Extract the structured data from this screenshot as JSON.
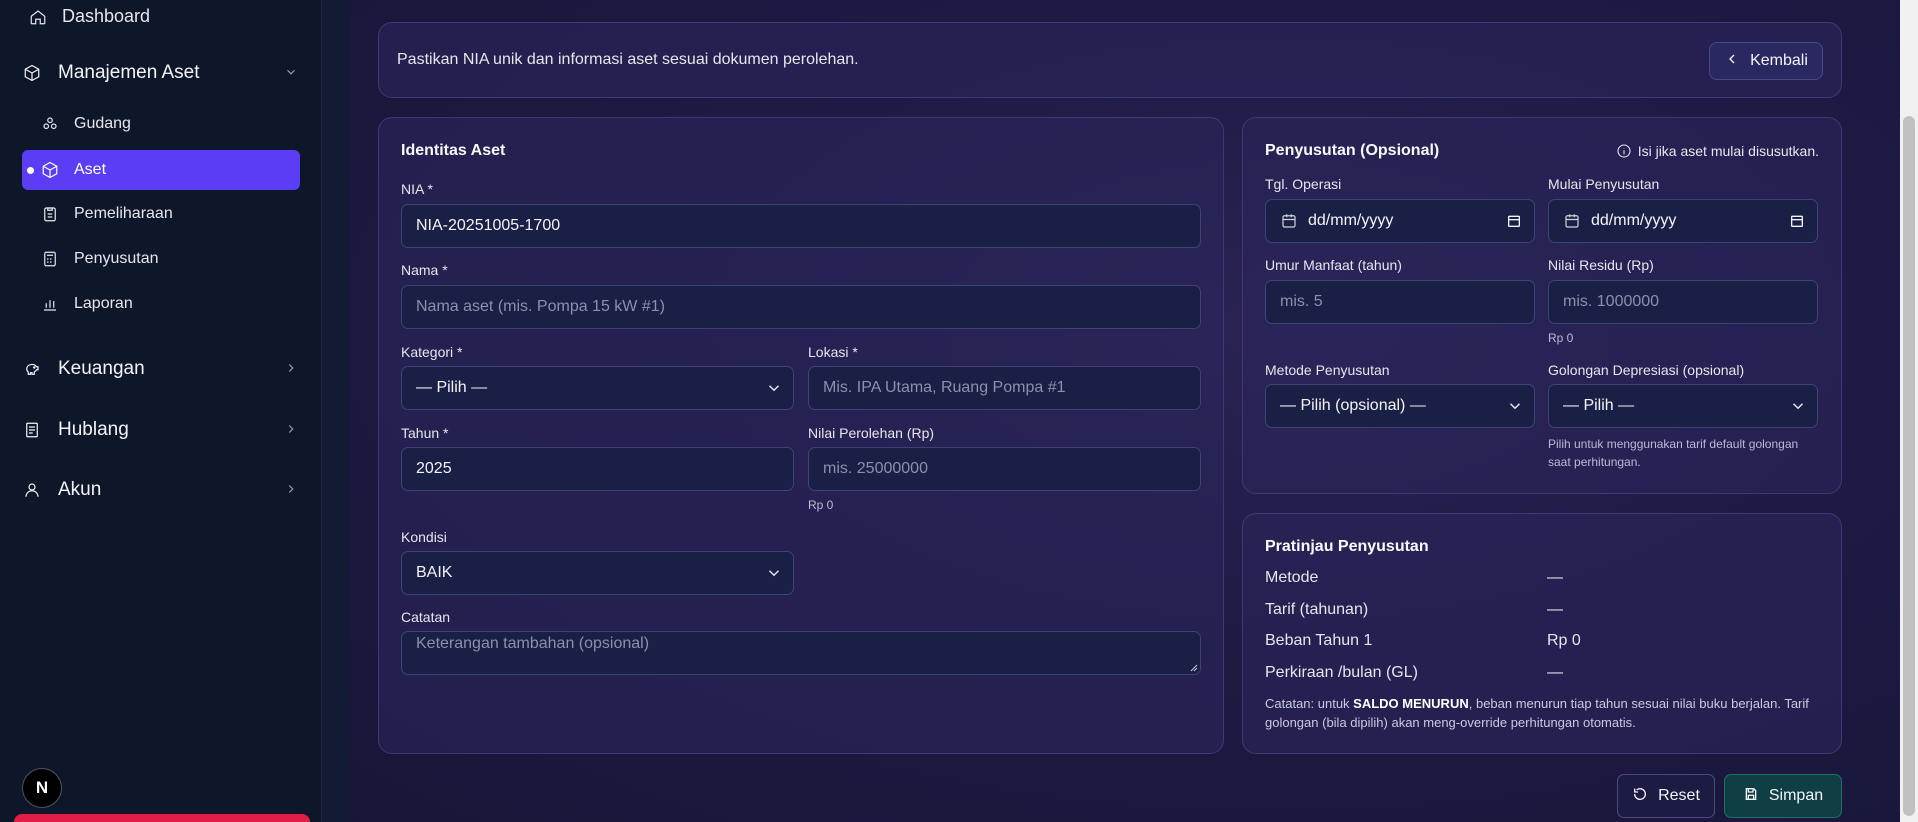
{
  "sidebar": {
    "dashboard": "Dashboard",
    "manajemen_aset": "Manajemen Aset",
    "sub_items": [
      "Gudang",
      "Aset",
      "Pemeliharaan",
      "Penyusutan",
      "Laporan"
    ],
    "keuangan": "Keuangan",
    "hublang": "Hublang",
    "akun": "Akun",
    "avatar_letter": "N"
  },
  "banner": {
    "message": "Pastikan NIA unik dan informasi aset sesuai dokumen perolehan.",
    "back_label": "Kembali"
  },
  "identitas": {
    "title": "Identitas Aset",
    "nia_label": "NIA *",
    "nia_value": "NIA-20251005-1700",
    "nama_label": "Nama *",
    "nama_placeholder": "Nama aset (mis. Pompa 15 kW #1)",
    "kategori_label": "Kategori *",
    "kategori_value": "— Pilih —",
    "lokasi_label": "Lokasi *",
    "lokasi_placeholder": "Mis. IPA Utama, Ruang Pompa #1",
    "tahun_label": "Tahun *",
    "tahun_value": "2025",
    "nilai_label": "Nilai Perolehan (Rp)",
    "nilai_placeholder": "mis. 25000000",
    "nilai_hint": "Rp 0",
    "kondisi_label": "Kondisi",
    "kondisi_value": "BAIK",
    "catatan_label": "Catatan",
    "catatan_placeholder": "Keterangan tambahan (opsional)"
  },
  "penyusutan": {
    "title": "Penyusutan (Opsional)",
    "note": "Isi jika aset mulai disusutkan.",
    "tgl_label": "Tgl. Operasi",
    "tgl_value": "dd/mm/yyyy",
    "mulai_label": "Mulai Penyusutan",
    "mulai_value": "dd/mm/yyyy",
    "umur_label": "Umur Manfaat (tahun)",
    "umur_placeholder": "mis. 5",
    "residu_label": "Nilai Residu (Rp)",
    "residu_placeholder": "mis. 1000000",
    "residu_hint": "Rp 0",
    "metode_label": "Metode Penyusutan",
    "metode_value": "— Pilih (opsional) —",
    "golongan_label": "Golongan Depresiasi (opsional)",
    "golongan_value": "— Pilih —",
    "golongan_hint": "Pilih untuk menggunakan tarif default golongan saat perhitungan."
  },
  "pratinjau": {
    "title": "Pratinjau Penyusutan",
    "rows": [
      {
        "key": "Metode",
        "value": "—"
      },
      {
        "key": "Tarif (tahunan)",
        "value": "—"
      },
      {
        "key": "Beban Tahun 1",
        "value": "Rp 0"
      },
      {
        "key": "Perkiraan /bulan (GL)",
        "value": "—"
      }
    ],
    "note_prefix": "Catatan: untuk ",
    "note_bold": "SALDO MENURUN",
    "note_suffix": ", beban menurun tiap tahun sesuai nilai buku berjalan. Tarif golongan (bila dipilih) akan meng-override perhitungan otomatis."
  },
  "actions": {
    "reset": "Reset",
    "save": "Simpan"
  }
}
